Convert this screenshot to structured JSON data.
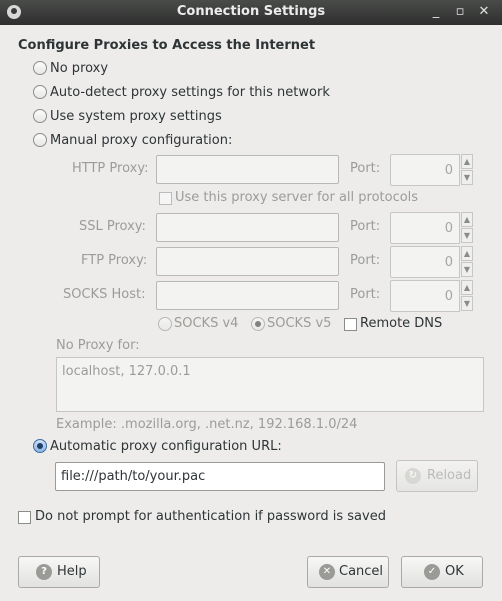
{
  "window": {
    "title": "Connection Settings"
  },
  "section_title": "Configure Proxies to Access the Internet",
  "options": {
    "no_proxy": "No proxy",
    "auto_detect": "Auto-detect proxy settings for this network",
    "system": "Use system proxy settings",
    "manual": "Manual proxy configuration:",
    "auto_url": "Automatic proxy configuration URL:"
  },
  "selected_option": "auto_url",
  "manual": {
    "http_label": "HTTP Proxy:",
    "ssl_label": "SSL Proxy:",
    "ftp_label": "FTP Proxy:",
    "socks_label": "SOCKS Host:",
    "port_label": "Port:",
    "port_value": "0",
    "use_all_label": "Use this proxy server for all protocols",
    "socks_v4": "SOCKS v4",
    "socks_v5": "SOCKS v5",
    "remote_dns": "Remote DNS",
    "no_proxy_label": "No Proxy for:",
    "no_proxy_value": "localhost, 127.0.0.1",
    "example": "Example: .mozilla.org, .net.nz, 192.168.1.0/24"
  },
  "auto_url": {
    "value": "file:///path/to/your.pac",
    "reload": "Reload"
  },
  "no_prompt": "Do not prompt for authentication if password is saved",
  "buttons": {
    "help": "Help",
    "cancel": "Cancel",
    "ok": "OK"
  },
  "icons": [
    "app-icon",
    "minimize-icon",
    "maximize-icon",
    "close-icon",
    "spin-up-icon",
    "spin-down-icon",
    "reload-icon",
    "help-icon",
    "cancel-icon",
    "ok-icon"
  ]
}
